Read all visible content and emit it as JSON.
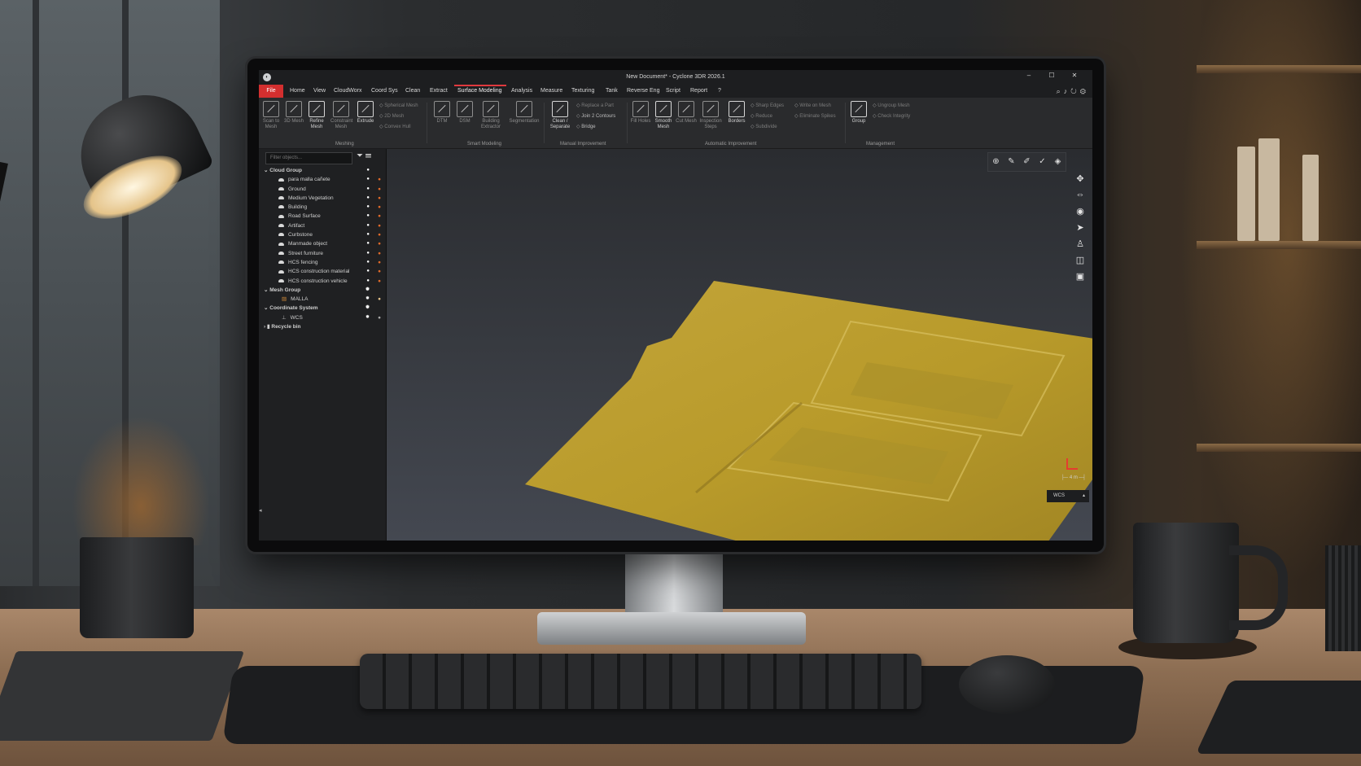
{
  "window": {
    "title": "New Document* - Cyclone 3DR 2026.1",
    "controls": [
      "–",
      "☐",
      "✕"
    ]
  },
  "menu": {
    "file": "File",
    "tabs": [
      "Home",
      "View",
      "CloudWorx",
      "Coord Sys",
      "Clean",
      "Extract",
      "Surface Modeling",
      "Analysis",
      "Measure",
      "Texturing",
      "Tank",
      "Reverse Eng",
      "Script",
      "Report",
      "?"
    ],
    "active_tab": "Surface Modeling"
  },
  "ribbon": {
    "meshing": {
      "group": "Meshing",
      "tools": [
        "Scan to Mesh",
        "3D Mesh",
        "Refine Mesh",
        "Constraint Mesh",
        "Extrude"
      ],
      "small": [
        "Spherical Mesh",
        "2D Mesh",
        "Convex Hull"
      ]
    },
    "smart": {
      "group": "Smart Modeling",
      "tools": [
        "DTM",
        "DSM",
        "Building Extractor",
        "Segmentation"
      ]
    },
    "manual": {
      "group": "Manual Improvement",
      "tools": [
        "Clean / Separate"
      ],
      "small": [
        "Replace a Part",
        "Join 2 Contours",
        "Bridge"
      ]
    },
    "automatic": {
      "group": "Automatic Improvement",
      "tools": [
        "Fill Holes",
        "Smooth Mesh",
        "Cut Mesh",
        "Inspection Steps",
        "Borders"
      ],
      "small": [
        "Sharp Edges",
        "Reduce",
        "Subdivide",
        "Write on Mesh",
        "Eliminate Spikes"
      ]
    },
    "management": {
      "group": "Management",
      "tools": [
        "Group"
      ],
      "small": [
        "Ungroup Mesh",
        "Check Integrity"
      ]
    }
  },
  "panel": {
    "filter_placeholder": "Filter objects...",
    "tree": [
      {
        "label": "Cloud Group",
        "level": 0,
        "group": true
      },
      {
        "label": "para malla cañete",
        "level": 1
      },
      {
        "label": "Ground",
        "level": 1
      },
      {
        "label": "Medium Vegetation",
        "level": 1
      },
      {
        "label": "Building",
        "level": 1
      },
      {
        "label": "Road Surface",
        "level": 1
      },
      {
        "label": "Artifact",
        "level": 1
      },
      {
        "label": "Curbstone",
        "level": 1
      },
      {
        "label": "Manmade object",
        "level": 1
      },
      {
        "label": "Street furniture",
        "level": 1
      },
      {
        "label": "HCS fencing",
        "level": 1
      },
      {
        "label": "HCS construction material",
        "level": 1
      },
      {
        "label": "HCS construction vehicle",
        "level": 1
      },
      {
        "label": "Mesh Group",
        "level": 0,
        "group": true
      },
      {
        "label": "MALLA",
        "level": 1
      },
      {
        "label": "Coordinate System",
        "level": 0,
        "group": true
      },
      {
        "label": "WCS",
        "level": 1
      },
      {
        "label": "Recycle bin",
        "level": 0,
        "group": true
      }
    ]
  },
  "viewport": {
    "scale_label": "4 m",
    "coord_system": "WCS",
    "mesh_color": "#b89a2a"
  },
  "colors": {
    "accent": "#d32f2f",
    "panel": "#1f2022",
    "ribbon": "#2a2b2d"
  }
}
